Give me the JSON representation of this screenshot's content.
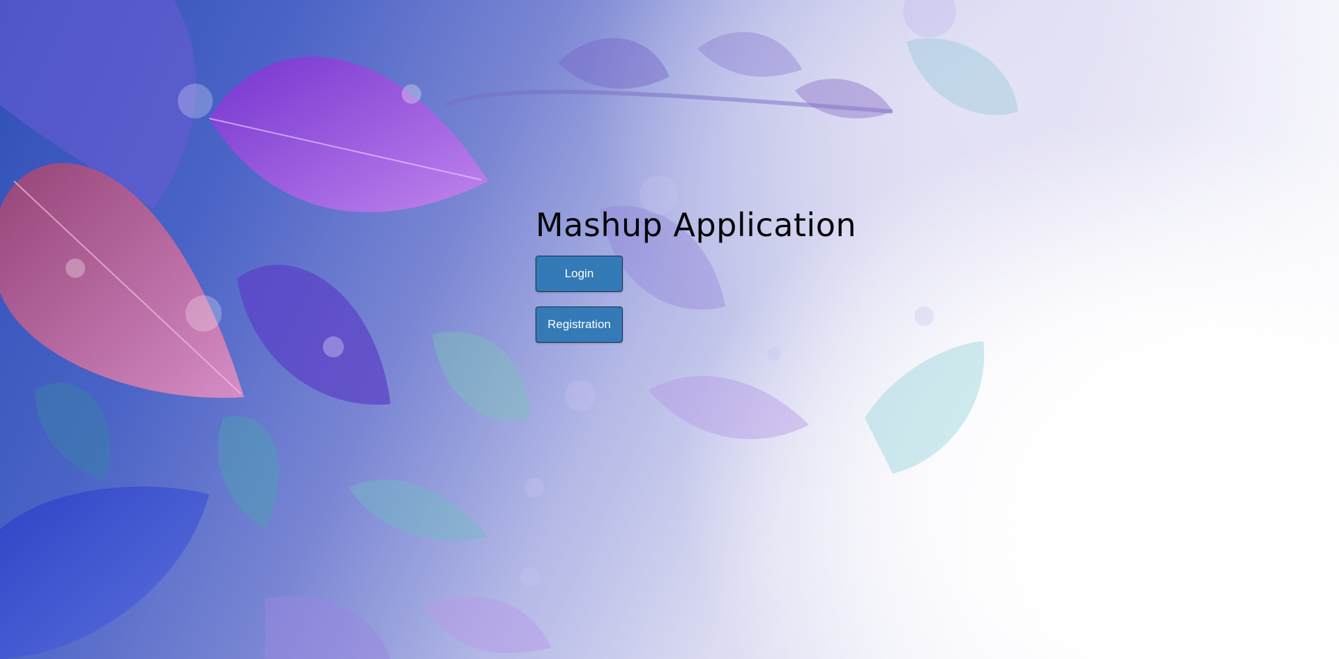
{
  "page": {
    "title": "Mashup Application"
  },
  "actions": {
    "login_label": "Login",
    "registration_label": "Registration"
  },
  "colors": {
    "button_bg": "#337ab7",
    "button_border": "#1c2f4a",
    "title_text": "#050505"
  },
  "background": {
    "decoration": "leaf-pattern-background"
  }
}
